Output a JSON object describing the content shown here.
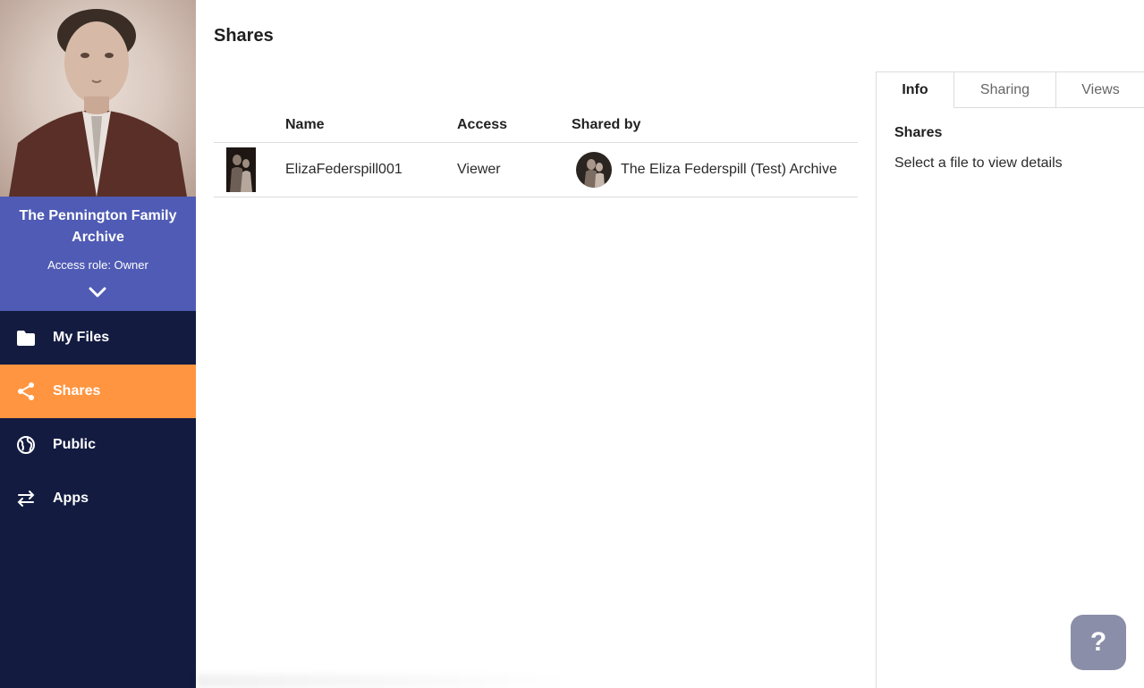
{
  "sidebar": {
    "archive_name": "The Pennington Family Archive",
    "access_role": "Access role: Owner",
    "nav": [
      {
        "label": "My Files",
        "icon": "folder-icon"
      },
      {
        "label": "Shares",
        "icon": "share-icon",
        "active": true
      },
      {
        "label": "Public",
        "icon": "globe-icon"
      },
      {
        "label": "Apps",
        "icon": "swap-arrows-icon"
      }
    ]
  },
  "main": {
    "title": "Shares",
    "columns": [
      "Name",
      "Access",
      "Shared by"
    ],
    "rows": [
      {
        "name": "ElizaFederspill001",
        "access": "Viewer",
        "shared_by": "The Eliza Federspill (Test) Archive"
      }
    ]
  },
  "details": {
    "tabs": [
      "Info",
      "Sharing",
      "Views"
    ],
    "active_tab": "Info",
    "heading": "Shares",
    "text": "Select a file to view details"
  },
  "help": {
    "label": "?"
  },
  "colors": {
    "sidebar": "#131b40",
    "archive_panel": "#4f5bb4",
    "active_nav": "#ff9540",
    "help": "#8a8ea8"
  }
}
